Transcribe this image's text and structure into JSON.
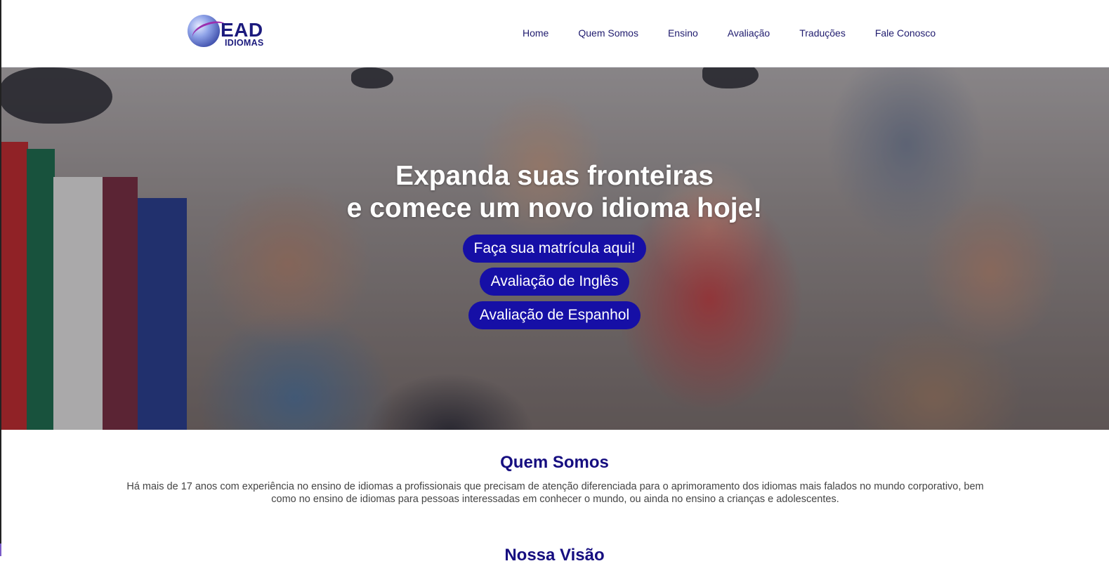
{
  "brand": {
    "name_main": "EAD",
    "name_sub": "IDIOMAS",
    "colors": {
      "primary": "#1b1a7d",
      "button": "#160fa6",
      "heading": "#160e80"
    }
  },
  "nav": {
    "items": [
      {
        "label": "Home"
      },
      {
        "label": "Quem Somos"
      },
      {
        "label": "Ensino"
      },
      {
        "label": "Avaliação"
      },
      {
        "label": "Traduções"
      },
      {
        "label": "Fale Conosco"
      }
    ]
  },
  "hero": {
    "title_line1": "Expanda suas fronteiras",
    "title_line2": "e comece um novo idioma hoje!",
    "buttons": [
      {
        "label": "Faça sua matrícula aqui!"
      },
      {
        "label": "Avaliação de Inglês"
      },
      {
        "label": "Avaliação de Espanhol"
      }
    ]
  },
  "about": {
    "title": "Quem Somos",
    "text": "Há mais de 17 anos com experiência no ensino de idiomas a profissionais que precisam de atenção diferenciada para o aprimoramento dos idiomas mais falados no mundo corporativo, bem como no ensino de idiomas para pessoas interessadas em conhecer o mundo, ou ainda no ensino a crianças e adolescentes."
  },
  "vision": {
    "title": "Nossa Visão"
  }
}
